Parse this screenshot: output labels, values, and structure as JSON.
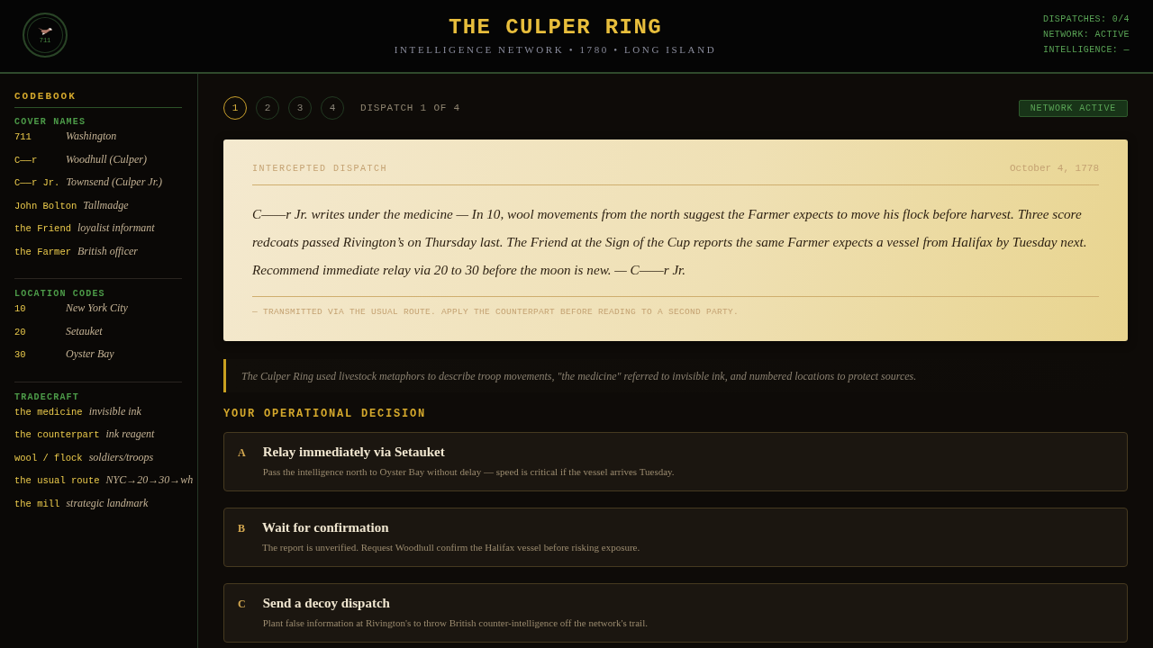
{
  "header": {
    "emblem_text": "711",
    "title": "THE CULPER RING",
    "subtitle": "INTELLIGENCE NETWORK • 1780 • LONG ISLAND",
    "status": [
      "DISPATCHES: 0/4",
      "NETWORK: ACTIVE",
      "INTELLIGENCE: —"
    ]
  },
  "sidebar": {
    "title": "CODEBOOK",
    "sections": [
      {
        "title": "COVER NAMES",
        "entries": [
          {
            "code": "711",
            "meaning": "Washington"
          },
          {
            "code": "C——r",
            "meaning": "Woodhull (Culper)"
          },
          {
            "code": "C——r Jr.",
            "meaning": "Townsend (Culper Jr.)"
          },
          {
            "code": "John Bolton",
            "meaning": "Tallmadge"
          },
          {
            "code": "the Friend",
            "meaning": "loyalist informant"
          },
          {
            "code": "the Farmer",
            "meaning": "British officer"
          }
        ]
      },
      {
        "title": "LOCATION CODES",
        "entries": [
          {
            "code": "10",
            "meaning": "New York City"
          },
          {
            "code": "20",
            "meaning": "Setauket"
          },
          {
            "code": "30",
            "meaning": "Oyster Bay"
          }
        ]
      },
      {
        "title": "TRADECRAFT",
        "entries": [
          {
            "code": "the medicine",
            "meaning": "invisible ink"
          },
          {
            "code": "the counterpart",
            "meaning": "ink reagent"
          },
          {
            "code": "wool / flock",
            "meaning": "soldiers/troops"
          },
          {
            "code": "the usual route",
            "meaning": "NYC→20→30→wh"
          },
          {
            "code": "the mill",
            "meaning": "strategic landmark"
          }
        ]
      }
    ]
  },
  "progress": {
    "steps": [
      {
        "label": "1",
        "selected": true
      },
      {
        "label": "2",
        "selected": false
      },
      {
        "label": "3",
        "selected": false
      },
      {
        "label": "4",
        "selected": false
      }
    ],
    "label": "DISPATCH 1 OF 4",
    "badge": "NETWORK ACTIVE"
  },
  "dispatch": {
    "heading": "INTERCEPTED DISPATCH",
    "date": "October 4, 1778",
    "body": "C——r Jr. writes under the medicine — In 10, wool movements from the north suggest the Farmer expects to move his flock before harvest. Three score redcoats passed Rivington’s on Thursday last. The Friend at the Sign of the Cup reports the same Farmer expects a vessel from Halifax by Tuesday next. Recommend immediate relay via 20 to 30 before the moon is new. — C——r Jr.",
    "footer": "— TRANSMITTED VIA THE USUAL ROUTE. APPLY THE COUNTERPART BEFORE READING TO A SECOND PARTY."
  },
  "note": "The Culper Ring used livestock metaphors to describe troop movements, \"the medicine\" referred to invisible ink, and numbered locations to protect sources.",
  "decision": {
    "title": "YOUR OPERATIONAL DECISION",
    "options": [
      {
        "letter": "A",
        "title": "Relay immediately via Setauket",
        "description": "Pass the intelligence north to Oyster Bay without delay — speed is critical if the vessel arrives Tuesday."
      },
      {
        "letter": "B",
        "title": "Wait for confirmation",
        "description": "The report is unverified. Request Woodhull confirm the Halifax vessel before risking exposure."
      },
      {
        "letter": "C",
        "title": "Send a decoy dispatch",
        "description": "Plant false information at Rivington's to throw British counter-intelligence off the network's trail."
      }
    ]
  }
}
